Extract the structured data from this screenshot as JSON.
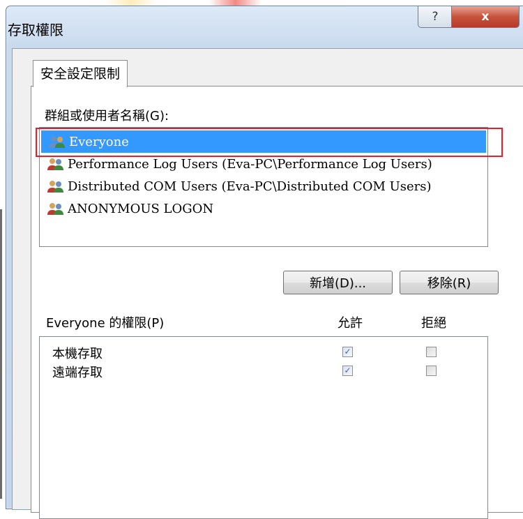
{
  "window": {
    "title": "存取權限",
    "help_glyph": "?",
    "close_glyph": "x"
  },
  "tab": {
    "label": "安全設定限制"
  },
  "groups": {
    "label": "群組或使用者名稱(G):",
    "items": [
      {
        "label": "Everyone",
        "selected": true
      },
      {
        "label": "Performance Log Users (Eva-PC\\Performance Log Users)",
        "selected": false
      },
      {
        "label": "Distributed COM Users (Eva-PC\\Distributed COM Users)",
        "selected": false
      },
      {
        "label": "ANONYMOUS LOGON",
        "selected": false
      }
    ]
  },
  "buttons": {
    "add": "新增(D)...",
    "remove": "移除(R)"
  },
  "permissions": {
    "label": "Everyone 的權限(P)",
    "allow_header": "允許",
    "deny_header": "拒絕",
    "rows": [
      {
        "label": "本機存取",
        "allow": true,
        "deny": false
      },
      {
        "label": "遠端存取",
        "allow": true,
        "deny": false
      }
    ]
  },
  "colors": {
    "selection": "#3399ff",
    "highlight_outline": "#e0202a"
  },
  "icons": {
    "user_group": "users-group-icon",
    "check": "checkmark"
  }
}
